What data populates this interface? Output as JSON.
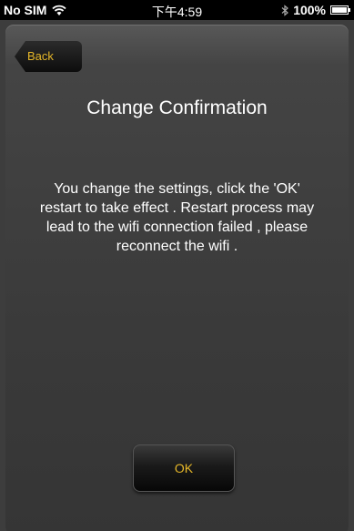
{
  "status_bar": {
    "carrier": "No SIM",
    "time": "下午4:59",
    "battery": "100%",
    "battery_level": 1.0,
    "icons": [
      "wifi-icon",
      "bluetooth-icon",
      "battery-icon"
    ]
  },
  "nav": {
    "back_label": "Back"
  },
  "dialog": {
    "title": "Change Confirmation",
    "message": "You change the settings, click the 'OK' restart to take effect . Restart process may lead to the wifi connection failed , please reconnect the wifi .",
    "ok_label": "OK"
  },
  "colors": {
    "accent": "#e7b829",
    "background": "#3d3d3d"
  }
}
